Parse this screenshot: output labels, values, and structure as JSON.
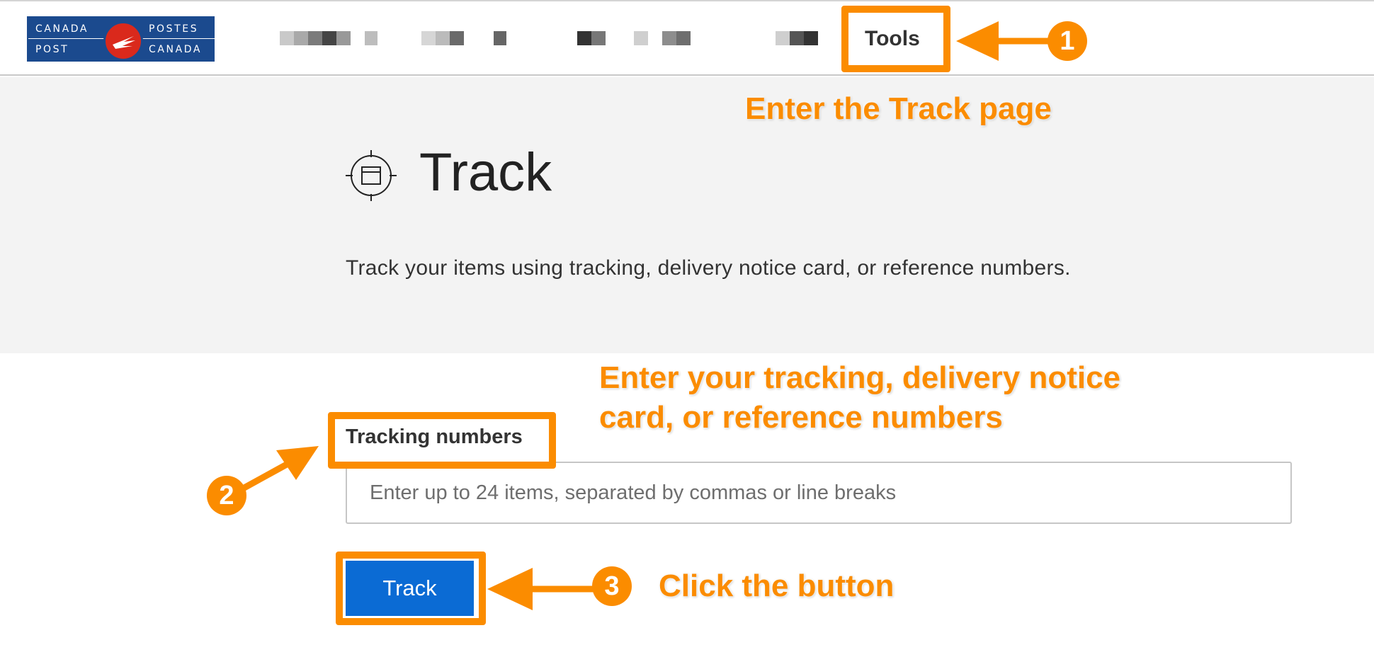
{
  "header": {
    "logo_top_left": "CANADA",
    "logo_top_right": "POSTES",
    "logo_bottom_left": "POST",
    "logo_bottom_right": "CANADA",
    "tools_label": "Tools"
  },
  "hero": {
    "title": "Track",
    "description": "Track your items using tracking, delivery notice card, or reference numbers."
  },
  "form": {
    "label": "Tracking numbers",
    "placeholder": "Enter up to 24 items, separated by commas or line breaks",
    "value": "",
    "button_label": "Track"
  },
  "annotations": {
    "step1": {
      "number": "1",
      "text": "Enter the Track page"
    },
    "step2": {
      "number": "2",
      "text_line1": "Enter your tracking, delivery notice",
      "text_line2": "card, or reference numbers"
    },
    "step3": {
      "number": "3",
      "text": "Click the button"
    }
  },
  "colors": {
    "accent_orange": "#fb8c00",
    "button_blue": "#0b6bd4",
    "logo_blue": "#1b4a8e",
    "logo_red": "#da291c",
    "hero_background": "#f3f3f3"
  },
  "icons": [
    "canada-post-logo",
    "track-target-icon",
    "arrow-icon"
  ]
}
